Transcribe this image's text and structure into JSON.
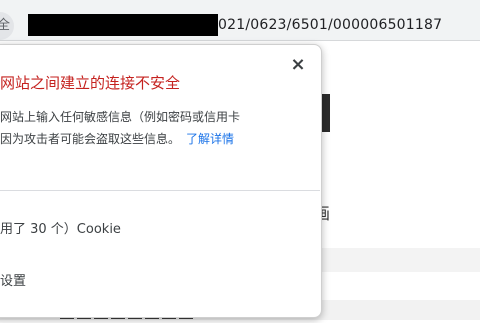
{
  "omnibox": {
    "url_visible": "021/0623/6501/000006501187"
  },
  "security_popup": {
    "close_symbol": "×",
    "title": "网站之间建立的连接不安全",
    "body_lines": [
      "网站上输入任何敏感信息（例如密码或信用卡",
      "因为攻击者可能会盗取这些信息。"
    ],
    "learn_more": "了解详情",
    "cookie_label": "用了 30 个）Cookie",
    "settings_label": "设置"
  },
  "page_background": {
    "heading_char": "画"
  },
  "colors": {
    "warning_red": "#c5221f",
    "link_blue": "#1a73e8"
  }
}
